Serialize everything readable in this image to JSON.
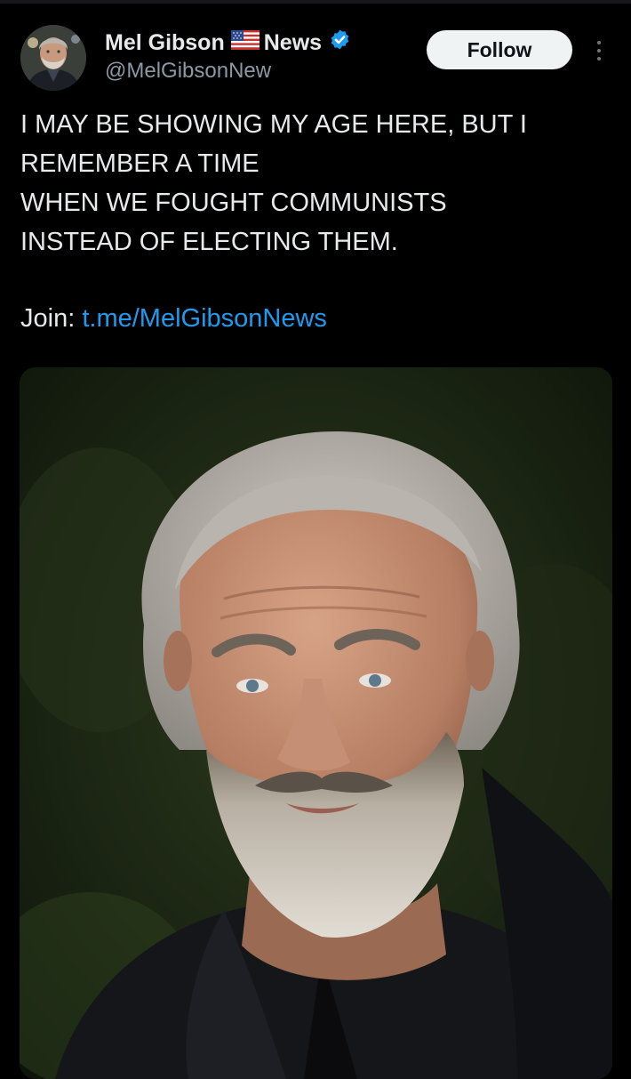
{
  "author": {
    "name_part1": "Mel Gibson",
    "name_part2": "News",
    "flag_icon": "us-flag-icon",
    "verified_icon": "verified-badge-icon",
    "handle": "@MelGibsonNew"
  },
  "header": {
    "follow_label": "Follow",
    "more_icon": "more-vertical-icon"
  },
  "tweet": {
    "lines": [
      "I MAY BE SHOWING MY AGE HERE, BUT I",
      "REMEMBER A TIME",
      "WHEN WE FOUGHT COMMUNISTS",
      "INSTEAD OF ELECTING THEM."
    ],
    "join_label": "Join:",
    "link_text": "t.me/MelGibsonNews"
  },
  "colors": {
    "background": "#000000",
    "text": "#e7e9ea",
    "secondary_text": "#8b98a5",
    "link": "#1d9bf0",
    "verified": "#1d9bf0",
    "follow_bg": "#eff3f4"
  }
}
